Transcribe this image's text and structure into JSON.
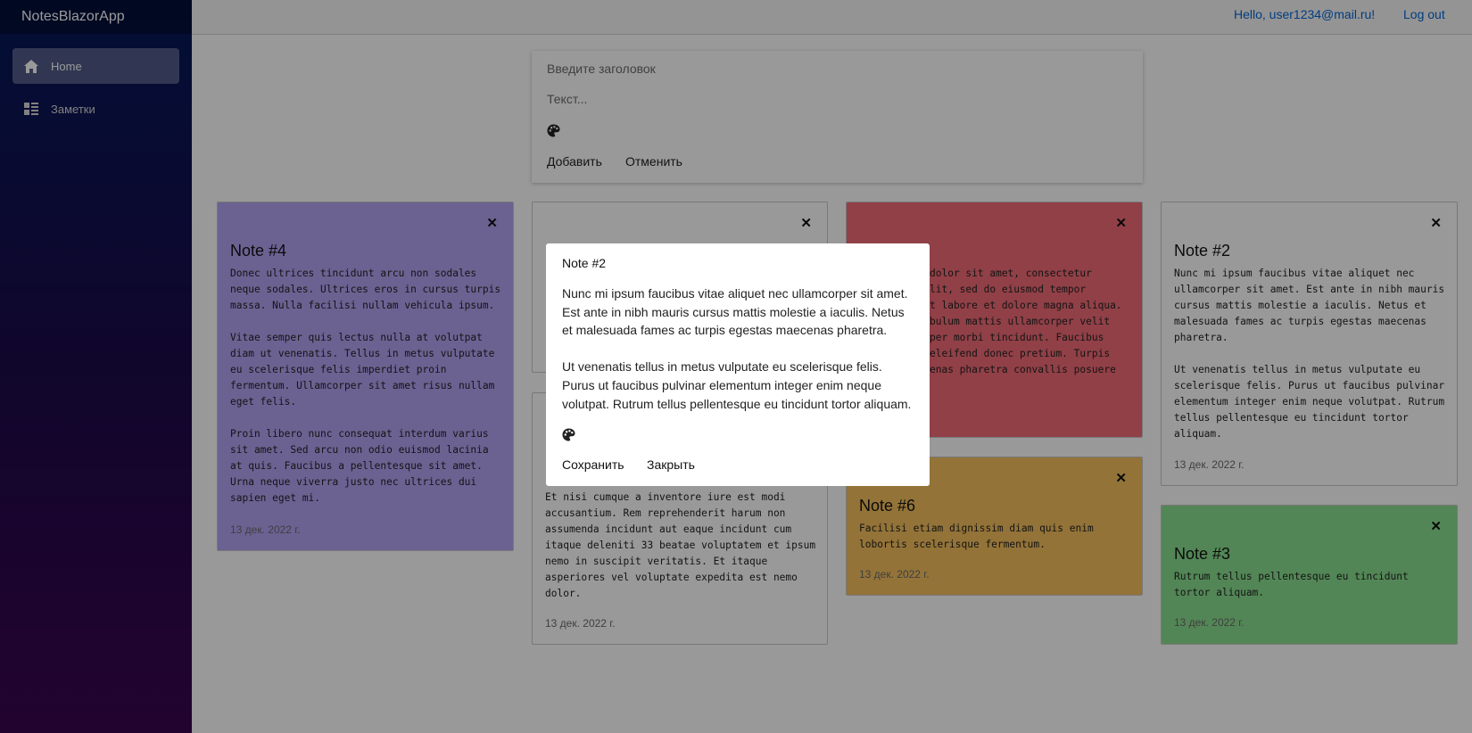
{
  "app": {
    "brand": "NotesBlazorApp"
  },
  "sidebar": {
    "items": [
      {
        "label": "Home",
        "icon": "home-icon",
        "active": true
      },
      {
        "label": "Заметки",
        "icon": "list-icon",
        "active": false
      }
    ]
  },
  "topbar": {
    "user": "Hello, user1234@mail.ru!",
    "logout": "Log out"
  },
  "composer": {
    "title_placeholder": "Введите заголовок",
    "text_placeholder": "Текст...",
    "palette_icon": "palette-icon",
    "add_label": "Добавить",
    "cancel_label": "Отменить"
  },
  "notes": [
    {
      "title": "Note #4",
      "color": "#b3a4f4",
      "body": "Donec ultrices tincidunt arcu non sodales\nneque sodales. Ultrices eros in cursus turpis\nmassa. Nulla facilisi nullam vehicula ipsum.\n\nVitae semper quis lectus nulla at volutpat\ndiam ut venenatis. Tellus in metus vulputate\neu scelerisque felis imperdiet proin\nfermentum. Ullamcorper sit amet risus nullam\neget felis.\n\nProin libero nunc consequat interdum varius\nsit amet. Sed arcu non odio euismod lacinia\nat quis. Faucibus a pellentesque sit amet.\nUrna neque viverra justo nec ultrices dui\nsapien eget mi.",
      "date": "13 дек. 2022 г."
    },
    {
      "title": "",
      "color": "#ffffff",
      "body": "",
      "date": ""
    },
    {
      "title": "",
      "color": "#ffffff",
      "body": "Et nisi cumque a inventore iure est modi\naccusantium. Rem reprehenderit harum non\nassumenda incidunt aut eaque incidunt cum\nitaque deleniti 33 beatae voluptatem et ipsum\nnemo in suscipit veritatis. Et itaque\nasperiores vel voluptate expedita est nemo\ndolor.",
      "date": "13 дек. 2022 г."
    },
    {
      "title": "",
      "color": "#f26b77",
      "body": "dolor sit amet, consectetur\nlit, sed do eiusmod tempor\nt labore et dolore magna aliqua.\nbulum mattis ullamcorper velit\nper morbi tincidunt. Faucibus\neleifend donec pretium. Turpis\nenas pharetra convallis posuere",
      "date": ""
    },
    {
      "title": "Note #6",
      "color": "#f6c05e",
      "body": "Facilisi etiam dignissim diam quis enim\nlobortis scelerisque fermentum.",
      "date": "13 дек. 2022 г."
    },
    {
      "title": "Note #2",
      "color": "#ffffff",
      "body": "Nunc mi ipsum faucibus vitae aliquet nec\nullamcorper sit amet. Est ante in nibh mauris\ncursus mattis molestie a iaculis. Netus et\nmalesuada fames ac turpis egestas maecenas\npharetra.\n\nUt venenatis tellus in metus vulputate eu\nscelerisque felis. Purus ut faucibus pulvinar\nelementum integer enim neque volutpat. Rutrum\ntellus pellentesque eu tincidunt tortor\naliquam.",
      "date": "13 дек. 2022 г."
    },
    {
      "title": "Note #3",
      "color": "#8be08f",
      "body": "Rutrum tellus pellentesque eu tincidunt\ntortor aliquam.",
      "date": "13 дек. 2022 г."
    }
  ],
  "modal": {
    "title": "Note #2",
    "body": "Nunc mi ipsum faucibus vitae aliquet nec ullamcorper sit amet. Est ante in nibh mauris cursus mattis molestie a iaculis. Netus et malesuada fames ac turpis egestas maecenas pharetra.\n\nUt venenatis tellus in metus vulputate eu scelerisque felis. Purus ut faucibus pulvinar elementum integer enim neque volutpat. Rutrum tellus pellentesque eu tincidunt tortor aliquam.",
    "palette_icon": "palette-icon",
    "save_label": "Сохранить",
    "close_label": "Закрыть"
  },
  "close_glyph": "✕"
}
